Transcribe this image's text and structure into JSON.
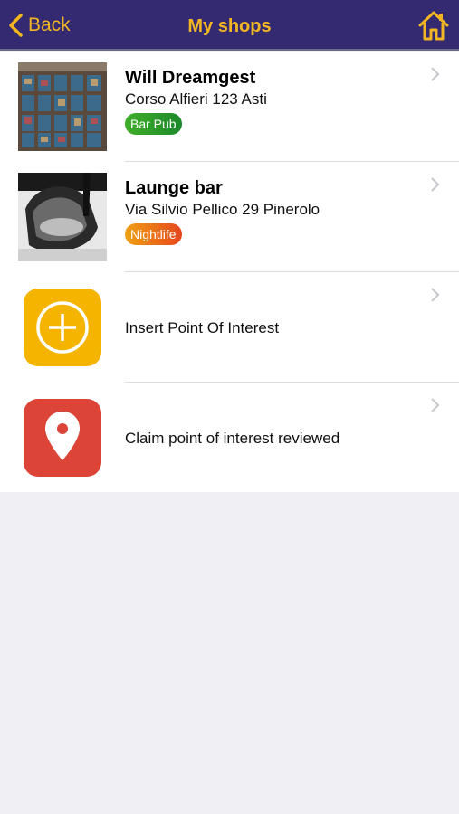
{
  "navbar": {
    "back_label": "Back",
    "title": "My shops",
    "back_icon": "chevron-left-icon",
    "home_icon": "home-icon",
    "accent_color": "#f3b623",
    "background_color": "#332a72"
  },
  "shops": [
    {
      "name": "Will Dreamgest",
      "address": "Corso Alfieri 123 Asti",
      "category": "Bar Pub",
      "category_color": "#2a9a2a"
    },
    {
      "name": "Launge bar",
      "address": "Via Silvio Pellico 29 Pinerolo",
      "category": "Nightlife",
      "category_color": "#e97a1a"
    }
  ],
  "actions": [
    {
      "label": "Insert Point Of Interest",
      "icon": "add-circle-icon",
      "color": "#f5b400"
    },
    {
      "label": "Claim point of interest reviewed",
      "icon": "map-pin-icon",
      "color": "#db4437"
    }
  ]
}
